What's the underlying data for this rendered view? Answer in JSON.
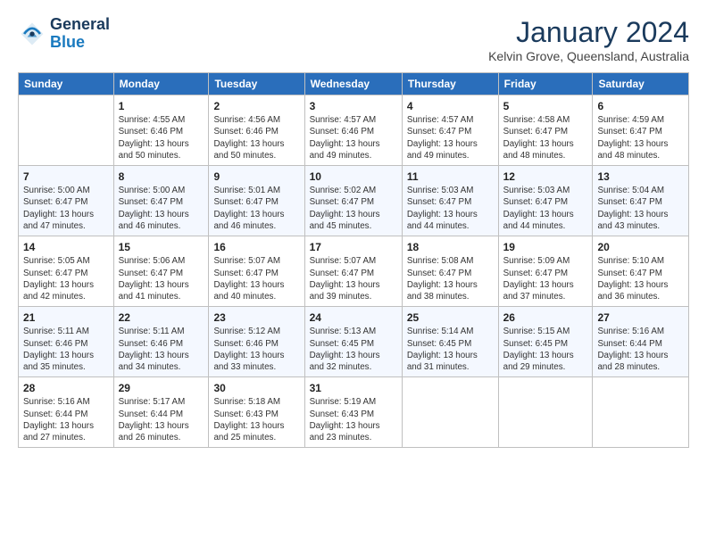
{
  "logo": {
    "line1": "General",
    "line2": "Blue"
  },
  "title": "January 2024",
  "location": "Kelvin Grove, Queensland, Australia",
  "days_header": [
    "Sunday",
    "Monday",
    "Tuesday",
    "Wednesday",
    "Thursday",
    "Friday",
    "Saturday"
  ],
  "weeks": [
    [
      {
        "day": "",
        "info": ""
      },
      {
        "day": "1",
        "info": "Sunrise: 4:55 AM\nSunset: 6:46 PM\nDaylight: 13 hours\nand 50 minutes."
      },
      {
        "day": "2",
        "info": "Sunrise: 4:56 AM\nSunset: 6:46 PM\nDaylight: 13 hours\nand 50 minutes."
      },
      {
        "day": "3",
        "info": "Sunrise: 4:57 AM\nSunset: 6:46 PM\nDaylight: 13 hours\nand 49 minutes."
      },
      {
        "day": "4",
        "info": "Sunrise: 4:57 AM\nSunset: 6:47 PM\nDaylight: 13 hours\nand 49 minutes."
      },
      {
        "day": "5",
        "info": "Sunrise: 4:58 AM\nSunset: 6:47 PM\nDaylight: 13 hours\nand 48 minutes."
      },
      {
        "day": "6",
        "info": "Sunrise: 4:59 AM\nSunset: 6:47 PM\nDaylight: 13 hours\nand 48 minutes."
      }
    ],
    [
      {
        "day": "7",
        "info": "Sunrise: 5:00 AM\nSunset: 6:47 PM\nDaylight: 13 hours\nand 47 minutes."
      },
      {
        "day": "8",
        "info": "Sunrise: 5:00 AM\nSunset: 6:47 PM\nDaylight: 13 hours\nand 46 minutes."
      },
      {
        "day": "9",
        "info": "Sunrise: 5:01 AM\nSunset: 6:47 PM\nDaylight: 13 hours\nand 46 minutes."
      },
      {
        "day": "10",
        "info": "Sunrise: 5:02 AM\nSunset: 6:47 PM\nDaylight: 13 hours\nand 45 minutes."
      },
      {
        "day": "11",
        "info": "Sunrise: 5:03 AM\nSunset: 6:47 PM\nDaylight: 13 hours\nand 44 minutes."
      },
      {
        "day": "12",
        "info": "Sunrise: 5:03 AM\nSunset: 6:47 PM\nDaylight: 13 hours\nand 44 minutes."
      },
      {
        "day": "13",
        "info": "Sunrise: 5:04 AM\nSunset: 6:47 PM\nDaylight: 13 hours\nand 43 minutes."
      }
    ],
    [
      {
        "day": "14",
        "info": "Sunrise: 5:05 AM\nSunset: 6:47 PM\nDaylight: 13 hours\nand 42 minutes."
      },
      {
        "day": "15",
        "info": "Sunrise: 5:06 AM\nSunset: 6:47 PM\nDaylight: 13 hours\nand 41 minutes."
      },
      {
        "day": "16",
        "info": "Sunrise: 5:07 AM\nSunset: 6:47 PM\nDaylight: 13 hours\nand 40 minutes."
      },
      {
        "day": "17",
        "info": "Sunrise: 5:07 AM\nSunset: 6:47 PM\nDaylight: 13 hours\nand 39 minutes."
      },
      {
        "day": "18",
        "info": "Sunrise: 5:08 AM\nSunset: 6:47 PM\nDaylight: 13 hours\nand 38 minutes."
      },
      {
        "day": "19",
        "info": "Sunrise: 5:09 AM\nSunset: 6:47 PM\nDaylight: 13 hours\nand 37 minutes."
      },
      {
        "day": "20",
        "info": "Sunrise: 5:10 AM\nSunset: 6:47 PM\nDaylight: 13 hours\nand 36 minutes."
      }
    ],
    [
      {
        "day": "21",
        "info": "Sunrise: 5:11 AM\nSunset: 6:46 PM\nDaylight: 13 hours\nand 35 minutes."
      },
      {
        "day": "22",
        "info": "Sunrise: 5:11 AM\nSunset: 6:46 PM\nDaylight: 13 hours\nand 34 minutes."
      },
      {
        "day": "23",
        "info": "Sunrise: 5:12 AM\nSunset: 6:46 PM\nDaylight: 13 hours\nand 33 minutes."
      },
      {
        "day": "24",
        "info": "Sunrise: 5:13 AM\nSunset: 6:45 PM\nDaylight: 13 hours\nand 32 minutes."
      },
      {
        "day": "25",
        "info": "Sunrise: 5:14 AM\nSunset: 6:45 PM\nDaylight: 13 hours\nand 31 minutes."
      },
      {
        "day": "26",
        "info": "Sunrise: 5:15 AM\nSunset: 6:45 PM\nDaylight: 13 hours\nand 29 minutes."
      },
      {
        "day": "27",
        "info": "Sunrise: 5:16 AM\nSunset: 6:44 PM\nDaylight: 13 hours\nand 28 minutes."
      }
    ],
    [
      {
        "day": "28",
        "info": "Sunrise: 5:16 AM\nSunset: 6:44 PM\nDaylight: 13 hours\nand 27 minutes."
      },
      {
        "day": "29",
        "info": "Sunrise: 5:17 AM\nSunset: 6:44 PM\nDaylight: 13 hours\nand 26 minutes."
      },
      {
        "day": "30",
        "info": "Sunrise: 5:18 AM\nSunset: 6:43 PM\nDaylight: 13 hours\nand 25 minutes."
      },
      {
        "day": "31",
        "info": "Sunrise: 5:19 AM\nSunset: 6:43 PM\nDaylight: 13 hours\nand 23 minutes."
      },
      {
        "day": "",
        "info": ""
      },
      {
        "day": "",
        "info": ""
      },
      {
        "day": "",
        "info": ""
      }
    ]
  ]
}
